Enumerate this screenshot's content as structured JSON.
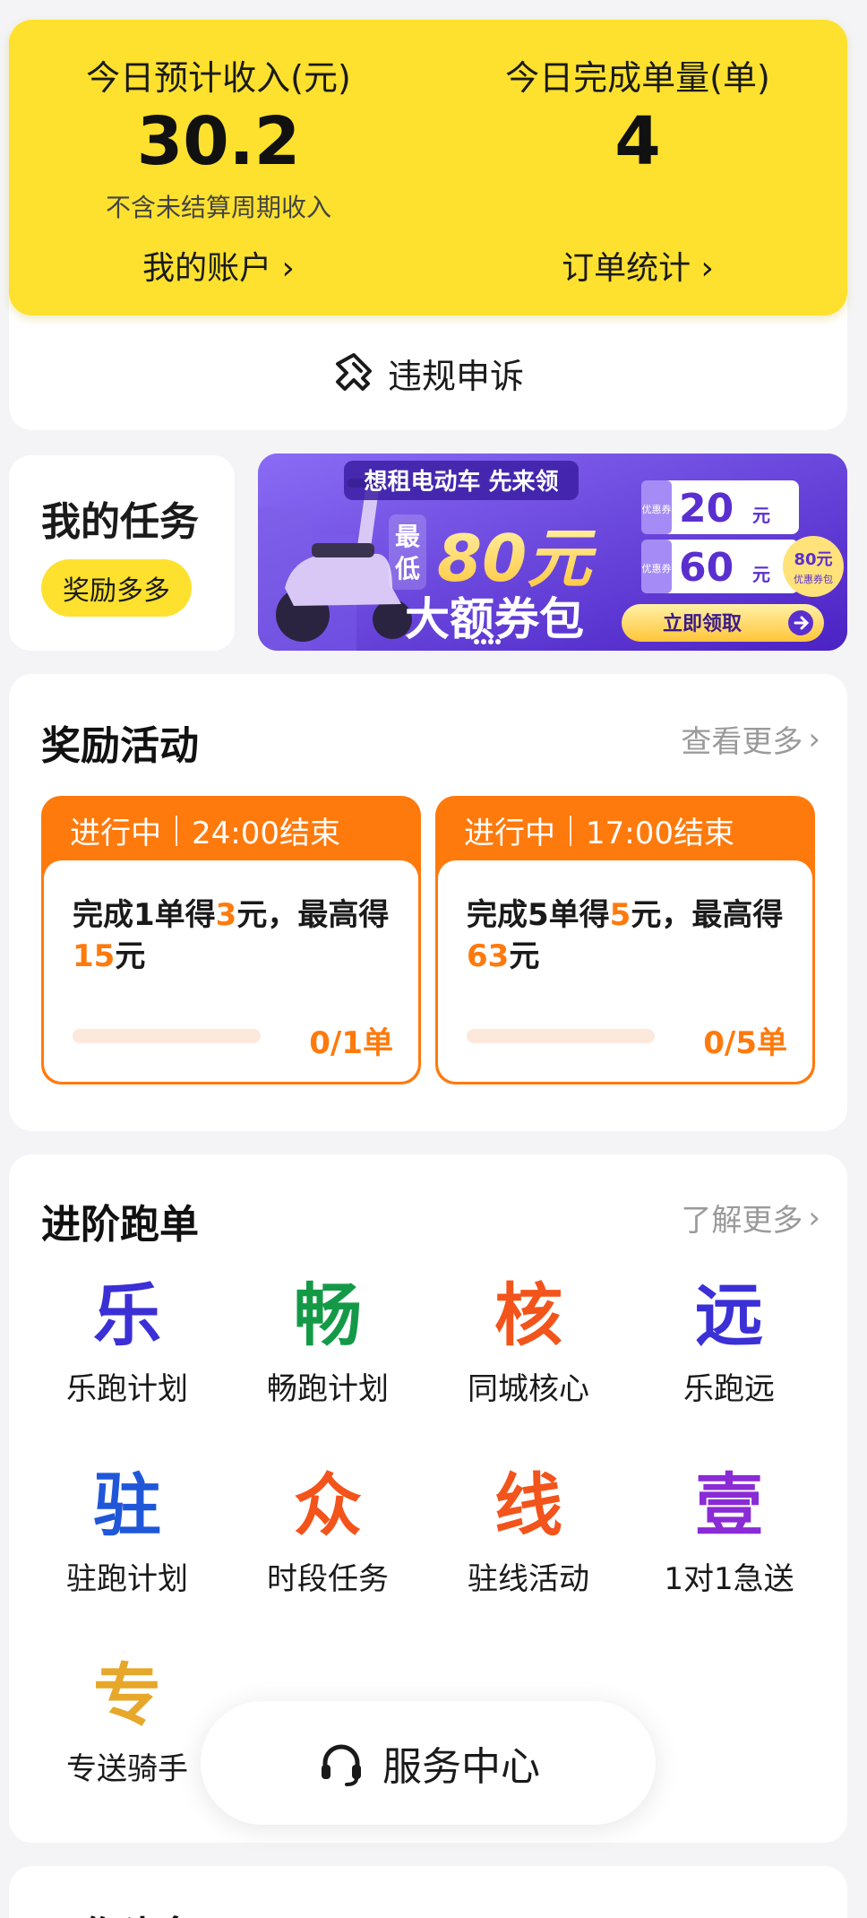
{
  "income": {
    "expected_label": "今日预计收入(元)",
    "expected_value": "30.2",
    "expected_note": "不含未结算周期收入",
    "account_link": "我的账户 ›",
    "orders_label": "今日完成单量(单)",
    "orders_value": "4",
    "stats_link": "订单统计 ›"
  },
  "appeal": {
    "label": "违规申诉",
    "icon": "appeal-icon"
  },
  "tasks": {
    "title": "我的任务",
    "badge": "奖励多多"
  },
  "banner": {
    "headline": "想租电动车 先来领",
    "prefix_top": "最",
    "prefix_bottom": "低",
    "amount": "80元",
    "subline": "大额券包",
    "coupon_tag": "优惠券",
    "coupon1": "20",
    "coupon2": "60",
    "unit": "元",
    "cta": "立即领取",
    "pack_label": "80元",
    "pack_sub": "优惠券包",
    "colors": {
      "bg": "#6c4ee6",
      "gold": "#ffd24a"
    }
  },
  "rewards": {
    "title": "奖励活动",
    "more": "查看更多",
    "items": [
      {
        "status": "进行中",
        "deadline": "24:00结束",
        "text_a": "完成1单得",
        "num_a": "3",
        "text_b": "元，最高得",
        "num_b": "15",
        "text_c": "元",
        "progress": "0/1单",
        "progress_fraction": 0
      },
      {
        "status": "进行中",
        "deadline": "17:00结束",
        "text_a": "完成5单得",
        "num_a": "5",
        "text_b": "元，最高得",
        "num_b": "63",
        "text_c": "元",
        "progress": "0/5单",
        "progress_fraction": 0
      }
    ]
  },
  "advanced": {
    "title": "进阶跑单",
    "more": "了解更多",
    "items": [
      {
        "glyph": "乐",
        "label": "乐跑计划",
        "color": "#3b2fd6"
      },
      {
        "glyph": "畅",
        "label": "畅跑计划",
        "color": "#149a47"
      },
      {
        "glyph": "核",
        "label": "同城核心",
        "color": "#f2541b"
      },
      {
        "glyph": "远",
        "label": "乐跑远",
        "color": "#3b2fd6"
      },
      {
        "glyph": "驻",
        "label": "驻跑计划",
        "color": "#1f57d8"
      },
      {
        "glyph": "众",
        "label": "时段任务",
        "color": "#f2541b"
      },
      {
        "glyph": "线",
        "label": "驻线活动",
        "color": "#f2541b"
      },
      {
        "glyph": "壹",
        "label": "1对1急送",
        "color": "#8a2bd6"
      },
      {
        "glyph": "专",
        "label": "专送骑手",
        "color": "#e6a72a"
      }
    ]
  },
  "service": {
    "label": "服务中心",
    "icon": "headset-icon"
  },
  "work": {
    "title": "工作头条"
  },
  "colors": {
    "yellow": "#fde12e",
    "orange": "#ff7a0d"
  }
}
